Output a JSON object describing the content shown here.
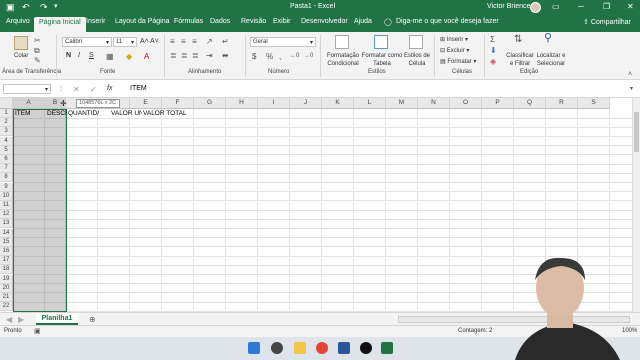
{
  "titlebar": {
    "title": "Pasta1  -  Excel",
    "user": "Victor Brience"
  },
  "tabs": [
    "Arquivo",
    "Página Inicial",
    "Inserir",
    "Layout da Página",
    "Fórmulas",
    "Dados",
    "Revisão",
    "Exibir",
    "Desenvolvedor",
    "Ajuda"
  ],
  "tellme": "Diga-me o que você deseja fazer",
  "share": "Compartilhar",
  "ribbon": {
    "clipboard": {
      "paste": "Colar",
      "label": "Área de Transferência"
    },
    "font": {
      "name": "Calibri",
      "size": "11",
      "label": "Fonte",
      "grow": "A˄",
      "shrink": "A˅"
    },
    "alignment": {
      "label": "Alinhamento"
    },
    "number": {
      "format": "Geral",
      "label": "Número"
    },
    "styles": {
      "conditional": "Formatação Condicional",
      "table": "Formatar como Tabela",
      "cell": "Estilos de Célula",
      "label": "Estilos"
    },
    "cells": {
      "insert": "Inserir",
      "delete": "Excluir",
      "format": "Formatar",
      "label": "Células"
    },
    "editing": {
      "sort": "Classificar e Filtrar",
      "find": "Localizar e Selecionar",
      "label": "Edição"
    }
  },
  "formula_bar": {
    "namebox": "",
    "fx": "fx",
    "content": "ITEM",
    "tooltip": "1048576L x 2C"
  },
  "grid": {
    "columns": [
      "A",
      "B",
      "C",
      "D",
      "E",
      "F",
      "G",
      "H",
      "I",
      "J",
      "K",
      "L",
      "M",
      "N",
      "O",
      "P",
      "Q",
      "R",
      "S"
    ],
    "rows": [
      "1",
      "2",
      "3",
      "4",
      "5",
      "6",
      "7",
      "8",
      "9",
      "10",
      "11",
      "12",
      "13",
      "14",
      "15",
      "16",
      "17",
      "18",
      "19",
      "20",
      "21",
      "22"
    ],
    "row1": [
      "ITEM",
      "DESCRIÇÃ",
      "QUANTID/",
      "VALOR UN",
      "VALOR TOTAL"
    ]
  },
  "sheet": {
    "name": "Planilha1"
  },
  "status": {
    "ready": "Pronto",
    "count": "Contagem: 2",
    "zoom": "100%"
  }
}
